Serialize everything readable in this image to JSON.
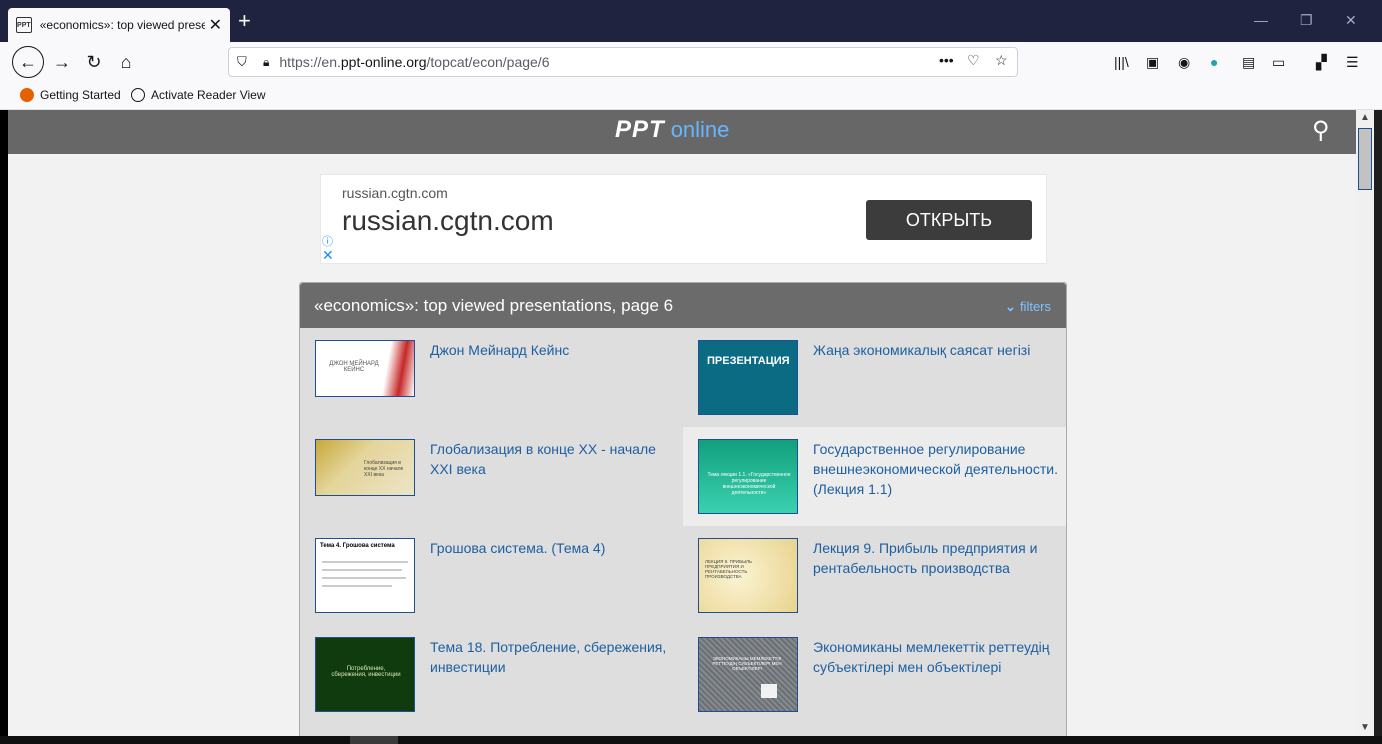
{
  "browser": {
    "tab_title": "«economics»: top viewed prese",
    "url_prefix": "https://en.",
    "url_domain": "ppt-online.org",
    "url_path": "/topcat/econ/page/6",
    "bookmarks": [
      "Getting Started",
      "Activate Reader View"
    ]
  },
  "site": {
    "logo_ppt": "PPT",
    "logo_online": "online"
  },
  "ad": {
    "small_domain": "russian.cgtn.com",
    "big_domain": "russian.cgtn.com",
    "button": "ОТКРЫТЬ"
  },
  "panel": {
    "title": "«economics»: top viewed presentations, page 6",
    "filters": "filters"
  },
  "items": [
    {
      "title": "Джон Мейнард Кейнс",
      "thumb_text": "ДЖОН МЕЙНАРД КЕЙНС"
    },
    {
      "title": "Жаңа экономикалық саясат негізі",
      "thumb_text": "ПРЕЗЕНТАЦИЯ"
    },
    {
      "title": "Глобализация в конце XX - начале XXI века",
      "thumb_text": "Глобализация в конце XX начале XXI века"
    },
    {
      "title": "Государственное регулирование внешнеэкономической деятельности. (Лекция 1.1)",
      "thumb_text": "Тема лекции 1.1. «Государственное регулирование внешнеэкономической деятельности»"
    },
    {
      "title": "Грошова система. (Тема 4)",
      "thumb_text": "Тема 4. Грошова система"
    },
    {
      "title": "Лекция 9. Прибыль предприятия и рентабельность производства",
      "thumb_text": "ЛЕКЦИЯ 9. ПРИБЫЛЬ ПРЕДПРИЯТИЯ И РЕНТАБЕЛЬНОСТЬ ПРОИЗВОДСТВА"
    },
    {
      "title": "Тема 18. Потребление, сбережения, инвестиции",
      "thumb_text": "Потребление, сбережения, инвестиции"
    },
    {
      "title": "Экономиканы мемлекеттік реттеудің субъектілері мен объектілері",
      "thumb_text": "ЭКОНОМИКАНЫ МЕМЛЕКЕТТІК РЕТТЕУДІҢ СУБЪЕКТІЛЕРІ МЕН ОБЪЕКТІЛЕРІ"
    }
  ]
}
